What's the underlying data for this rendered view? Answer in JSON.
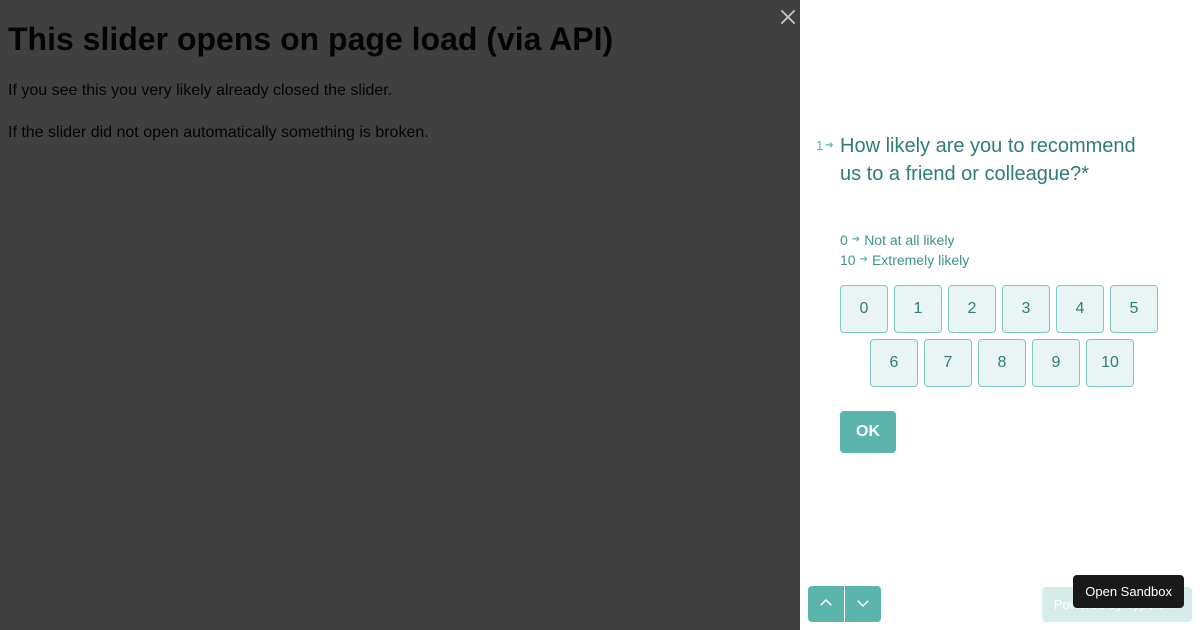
{
  "page": {
    "heading": "This slider opens on page load (via API)",
    "line1": "If you see this you very likely already closed the slider.",
    "line2": "If the slider did not open automatically something is broken."
  },
  "survey": {
    "question_number": "1",
    "question": "How likely are you to recommend us to a friend or colleague?*",
    "legend_low_key": "0",
    "legend_low_label": "Not at all likely",
    "legend_high_key": "10",
    "legend_high_label": "Extremely likely",
    "options": [
      "0",
      "1",
      "2",
      "3",
      "4",
      "5",
      "6",
      "7",
      "8",
      "9",
      "10"
    ],
    "ok_label": "OK",
    "powered_by": "Powered by Typeform"
  },
  "sandbox": {
    "label": "Open Sandbox"
  },
  "colors": {
    "accent": "#5cb5ad",
    "accent_dark": "#2f7d78",
    "option_bg": "#e9f5f4",
    "option_border": "#7cc7c0",
    "overlay": "rgba(0,0,0,0.75)"
  }
}
